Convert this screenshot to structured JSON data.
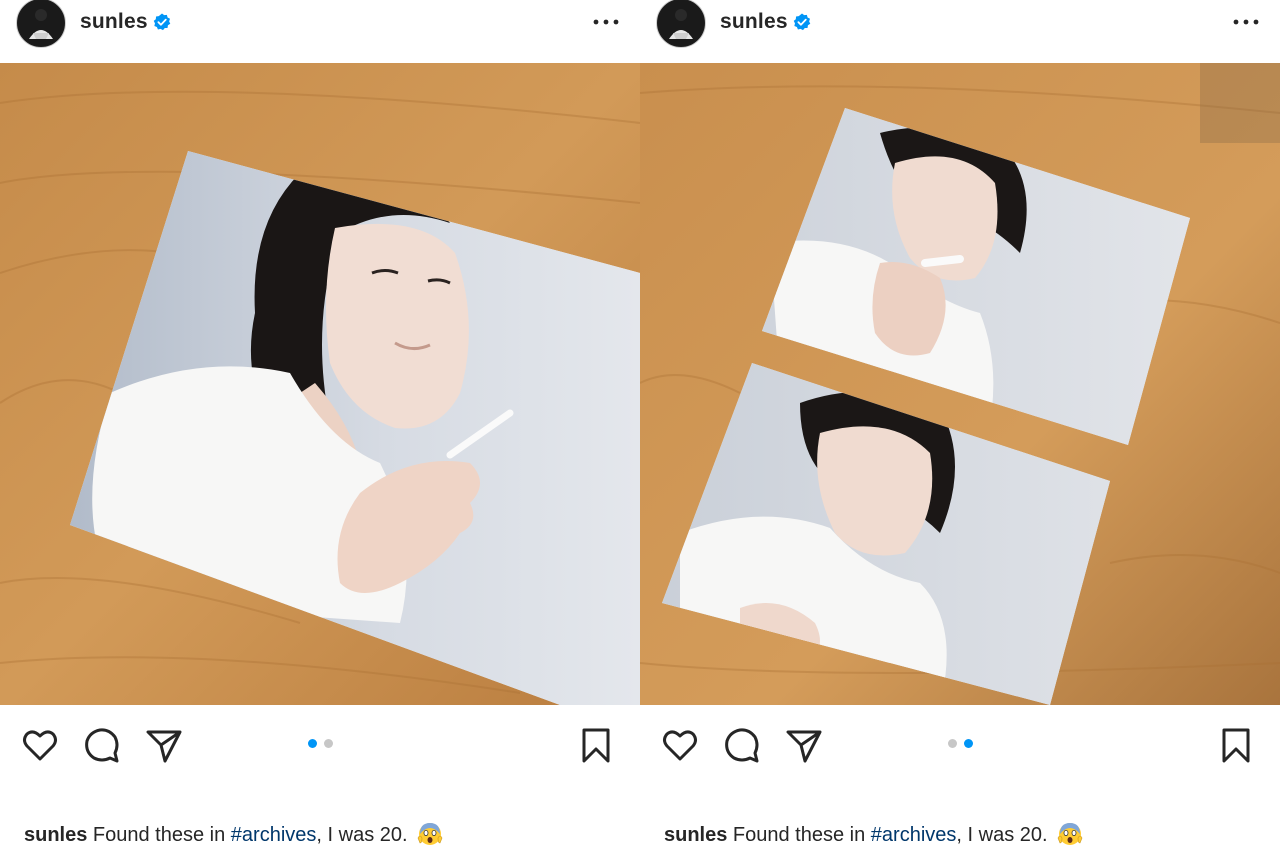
{
  "posts": [
    {
      "id": "left",
      "username": "sunles",
      "caption": {
        "username": "sunles",
        "text_before": " Found these in ",
        "hashtag": "#archives",
        "text_after": ", I was 20.",
        "emoji": "face-screaming-in-fear-emoji"
      },
      "carousel": {
        "total": 2,
        "active": 1
      },
      "icons": [
        "like-heart-icon",
        "comment-bubble-icon",
        "share-paper-plane-icon",
        "save-bookmark-icon",
        "more-options-icon",
        "verified-badge-icon"
      ]
    },
    {
      "id": "right",
      "username": "sunles",
      "caption": {
        "username": "sunles",
        "text_before": " Found these in ",
        "hashtag": "#archives",
        "text_after": ", I was 20.",
        "emoji": "face-screaming-in-fear-emoji"
      },
      "carousel": {
        "total": 2,
        "active": 2
      },
      "icons": [
        "like-heart-icon",
        "comment-bubble-icon",
        "share-paper-plane-icon",
        "save-bookmark-icon",
        "more-options-icon",
        "verified-badge-icon"
      ]
    }
  ],
  "colors": {
    "text": "#262626",
    "verified": "#0095f6",
    "carousel_active": "#0095f6",
    "carousel_inactive": "#c7c7c7",
    "hashtag": "#00376b",
    "wood": "#c68f4e"
  }
}
